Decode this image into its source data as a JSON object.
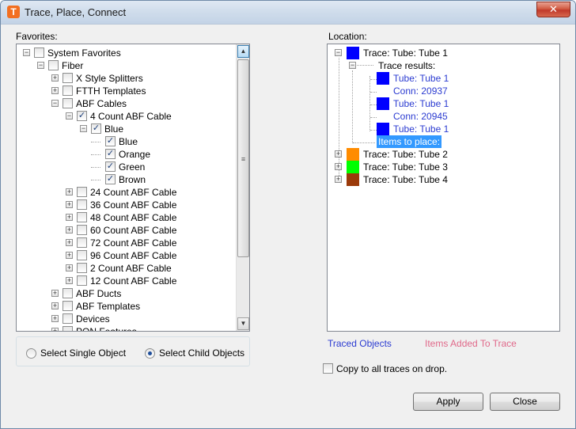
{
  "window": {
    "title": "Trace, Place, Connect",
    "close_glyph": "✕",
    "app_icon_glyph": "T"
  },
  "favorites": {
    "label": "Favorites:",
    "tree": [
      {
        "label": "System Favorites",
        "level": 0,
        "expander": "−",
        "checked": false
      },
      {
        "label": "Fiber",
        "level": 1,
        "expander": "−",
        "checked": false
      },
      {
        "label": "X Style Splitters",
        "level": 2,
        "expander": "+",
        "checked": false
      },
      {
        "label": "FTTH Templates",
        "level": 2,
        "expander": "+",
        "checked": false
      },
      {
        "label": "ABF Cables",
        "level": 2,
        "expander": "−",
        "checked": false
      },
      {
        "label": "4 Count ABF Cable",
        "level": 3,
        "expander": "−",
        "checked": true
      },
      {
        "label": "Blue",
        "level": 4,
        "expander": "−",
        "checked": true
      },
      {
        "label": "Blue",
        "level": 5,
        "expander": "",
        "checked": true
      },
      {
        "label": "Orange",
        "level": 5,
        "expander": "",
        "checked": true
      },
      {
        "label": "Green",
        "level": 5,
        "expander": "",
        "checked": true
      },
      {
        "label": "Brown",
        "level": 5,
        "expander": "",
        "checked": true
      },
      {
        "label": "24 Count ABF Cable",
        "level": 3,
        "expander": "+",
        "checked": false
      },
      {
        "label": "36 Count ABF Cable",
        "level": 3,
        "expander": "+",
        "checked": false
      },
      {
        "label": "48 Count ABF Cable",
        "level": 3,
        "expander": "+",
        "checked": false
      },
      {
        "label": "60 Count ABF Cable",
        "level": 3,
        "expander": "+",
        "checked": false
      },
      {
        "label": "72 Count ABF Cable",
        "level": 3,
        "expander": "+",
        "checked": false
      },
      {
        "label": "96 Count ABF Cable",
        "level": 3,
        "expander": "+",
        "checked": false
      },
      {
        "label": "2 Count ABF Cable",
        "level": 3,
        "expander": "+",
        "checked": false
      },
      {
        "label": "12 Count ABF Cable",
        "level": 3,
        "expander": "+",
        "checked": false
      },
      {
        "label": "ABF Ducts",
        "level": 2,
        "expander": "+",
        "checked": false
      },
      {
        "label": "ABF Templates",
        "level": 2,
        "expander": "+",
        "checked": false
      },
      {
        "label": "Devices",
        "level": 2,
        "expander": "+",
        "checked": false
      },
      {
        "label": "PON Features",
        "level": 2,
        "expander": "+",
        "checked": false
      }
    ],
    "scroll_up": "▲",
    "scroll_down": "▼",
    "thumb_grip": "≡"
  },
  "selection_mode": {
    "single_label": "Select Single Object",
    "child_label": "Select Child Objects",
    "selected": "child"
  },
  "location": {
    "label": "Location:",
    "tree": {
      "trace1": {
        "label": "Trace: Tube: Tube 1",
        "color": "#0000ff",
        "expander": "−"
      },
      "trace_results": {
        "label": "Trace results:",
        "expander": "−"
      },
      "results": [
        {
          "label": "Tube: Tube 1",
          "color": "#0000ff",
          "kind": "tube"
        },
        {
          "label": "Conn: 20937",
          "kind": "conn"
        },
        {
          "label": "Tube: Tube 1",
          "color": "#0000ff",
          "kind": "tube"
        },
        {
          "label": "Conn: 20945",
          "kind": "conn"
        },
        {
          "label": "Tube: Tube 1",
          "color": "#0000ff",
          "kind": "tube"
        }
      ],
      "items_to_place": "Items to place:",
      "trace2": {
        "label": "Trace: Tube: Tube 2",
        "color": "#ff8c00",
        "expander": "+"
      },
      "trace3": {
        "label": "Trace: Tube: Tube 3",
        "color": "#00ff00",
        "expander": "+"
      },
      "trace4": {
        "label": "Trace: Tube: Tube 4",
        "color": "#9b3a0a",
        "expander": "+"
      }
    }
  },
  "legend": {
    "traced_objects": "Traced Objects",
    "traced_color": "#2b3bd1",
    "items_added": "Items Added To Trace",
    "items_added_color": "#e0698a"
  },
  "copy_option": {
    "label": "Copy to all traces on drop.",
    "checked": false
  },
  "buttons": {
    "apply": "Apply",
    "close": "Close"
  }
}
